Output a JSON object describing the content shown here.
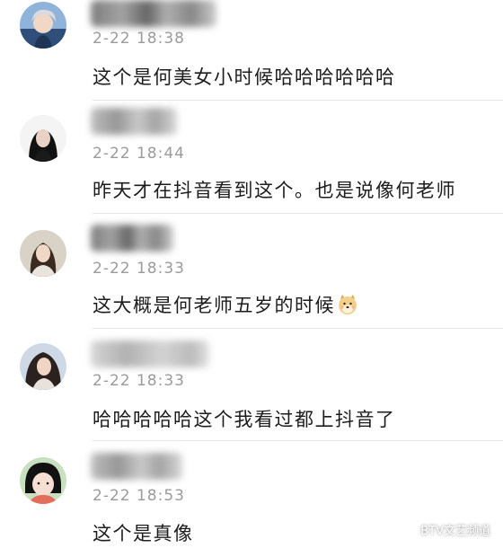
{
  "comments": [
    {
      "time": "2-22 18:38",
      "text": "这个是何美女小时候哈哈哈哈哈哈"
    },
    {
      "time": "2-22 18:44",
      "text": "昨天才在抖音看到这个。也是说像何老师"
    },
    {
      "time": "2-22 18:33",
      "text": "这大概是何老师五岁的时候",
      "emoji": "dog-emoji"
    },
    {
      "time": "2-22 18:33",
      "text": "哈哈哈哈哈这个我看过都上抖音了"
    },
    {
      "time": "2-22 18:53",
      "text": "这个是真像"
    }
  ],
  "watermark": {
    "label": "BTV文艺频道",
    "icon": "wechat-icon"
  }
}
